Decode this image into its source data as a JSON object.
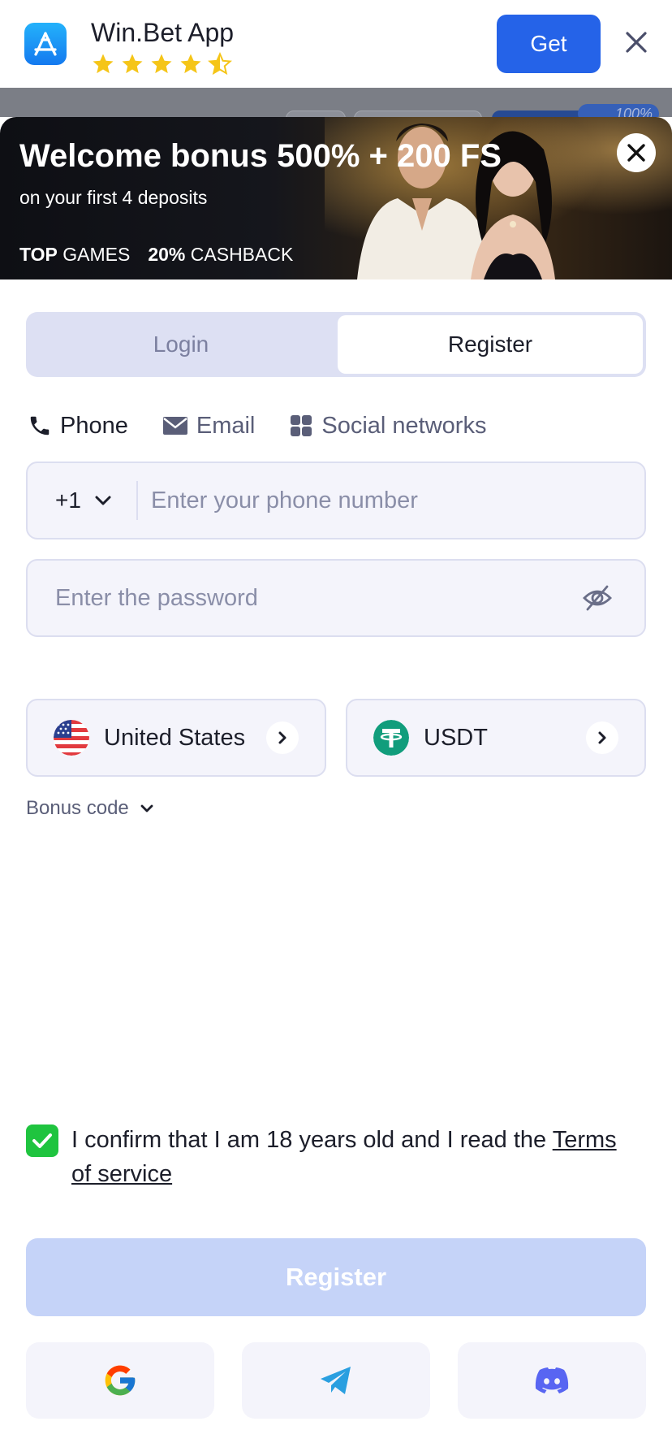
{
  "app_banner": {
    "app_name": "Win.Bet App",
    "rating_stars": 4.5,
    "get_label": "Get"
  },
  "behind": {
    "percent_badge": "100%"
  },
  "promo": {
    "title": "Welcome bonus 500% + 200 FS",
    "subtitle": "on your first 4 deposits",
    "tag1_bold": "TOP",
    "tag1_rest": " GAMES",
    "tag2_bold": "20%",
    "tag2_rest": " CASHBACK"
  },
  "tabs": {
    "login": "Login",
    "register": "Register"
  },
  "methods": {
    "phone": "Phone",
    "email": "Email",
    "social": "Social networks"
  },
  "form": {
    "country_code": "+1",
    "phone_placeholder": "Enter your phone number",
    "password_placeholder": "Enter the password",
    "country": "United States",
    "currency": "USDT",
    "bonus_code": "Bonus code"
  },
  "confirm": {
    "checked": true,
    "text": "I confirm that I am 18 years old and I read the ",
    "link": "Terms of service"
  },
  "register_button": "Register",
  "social_logins": [
    "google-icon",
    "telegram-icon",
    "discord-icon"
  ],
  "colors": {
    "primary": "#2563e8",
    "register_disabled": "#c5d3f8",
    "checkbox": "#1fc43f",
    "field_bg": "#f4f4fb"
  }
}
